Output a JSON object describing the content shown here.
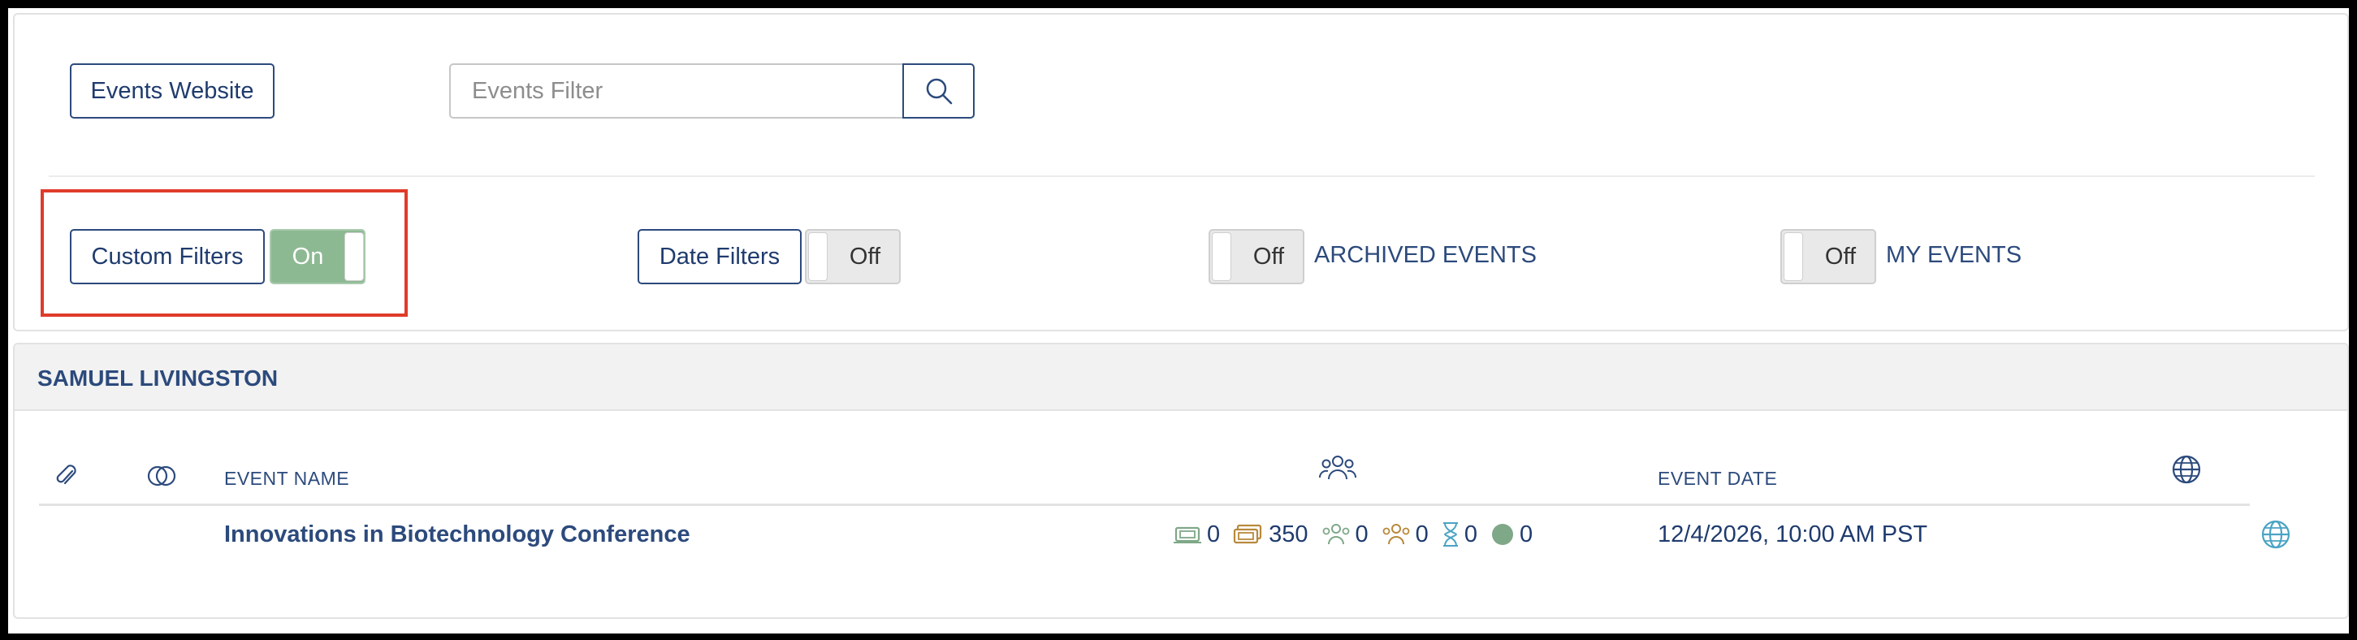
{
  "top_bar": {
    "events_website_label": "Events Website",
    "search_placeholder": "Events Filter"
  },
  "filters": {
    "custom_filters_label": "Custom Filters",
    "custom_filters_state": "On",
    "date_filters_label": "Date Filters",
    "date_filters_state": "Off",
    "archived_state": "Off",
    "archived_label": "ARCHIVED EVENTS",
    "my_events_state": "Off",
    "my_events_label": "MY EVENTS"
  },
  "section": {
    "title": "SAMUEL LIVINGSTON",
    "columns": {
      "event_name": "EVENT NAME",
      "event_date": "EVENT DATE"
    },
    "rows": [
      {
        "name": "Innovations in Biotechnology Conference",
        "stats": [
          "0",
          "350",
          "0",
          "0",
          "0",
          "0"
        ],
        "date": "12/4/2026, 10:00 AM PST"
      }
    ]
  },
  "colors": {
    "accent": "#2c4a7c",
    "toggle_on": "#8db992",
    "highlight": "#e03b2a",
    "teal_icon": "#4aa3c4",
    "gold_icon": "#b8893b",
    "green_dot": "#7fa888"
  },
  "icons": [
    "search-icon",
    "paperclip-icon",
    "rings-icon",
    "people-icon",
    "globe-icon",
    "ticket-icon",
    "tickets-stack-icon",
    "attendee-icon",
    "group-icon",
    "hourglass-icon",
    "status-dot-icon"
  ]
}
